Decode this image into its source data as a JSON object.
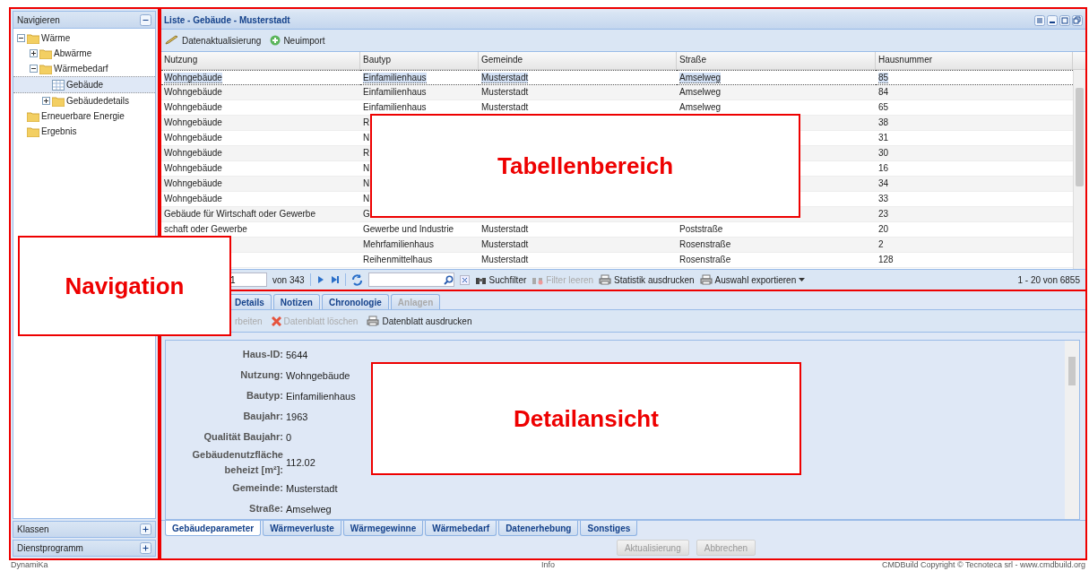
{
  "navigation": {
    "title": "Navigieren",
    "tree": [
      {
        "label": "Wärme",
        "kind": "folder",
        "expanded": true,
        "selected": false,
        "children": [
          {
            "label": "Abwärme",
            "kind": "folder",
            "expanded": false,
            "selected": false,
            "has_children": true
          },
          {
            "label": "Wärmebedarf",
            "kind": "folder",
            "expanded": true,
            "selected": false,
            "children": [
              {
                "label": "Gebäude",
                "kind": "table",
                "selected": true
              },
              {
                "label": "Gebäudedetails",
                "kind": "folder",
                "expanded": false,
                "selected": false,
                "has_children": true
              }
            ]
          }
        ]
      },
      {
        "label": "Erneuerbare Energie",
        "kind": "folder",
        "selected": false
      },
      {
        "label": "Ergebnis",
        "kind": "folder",
        "selected": false
      }
    ],
    "accordion": [
      {
        "label": "Klassen"
      },
      {
        "label": "Dienstprogramm"
      }
    ]
  },
  "list": {
    "title": "Liste - Gebäude - Musterstadt",
    "toolbar": [
      {
        "label": "Datenaktualisierung",
        "kind": "update"
      },
      {
        "label": "Neuimport",
        "kind": "add"
      }
    ],
    "columns": [
      "Nutzung",
      "Bautyp",
      "Gemeinde",
      "Straße",
      "Hausnummer"
    ],
    "rows": [
      {
        "selected": true,
        "nutzung": "Wohngebäude",
        "bautyp": "Einfamilienhaus",
        "gemeinde": "Musterstadt",
        "strasse": "Amselweg",
        "hausnummer": "85"
      },
      {
        "selected": false,
        "nutzung": "Wohngebäude",
        "bautyp": "Einfamilienhaus",
        "gemeinde": "Musterstadt",
        "strasse": "Amselweg",
        "hausnummer": "84"
      },
      {
        "selected": false,
        "nutzung": "Wohngebäude",
        "bautyp": "Einfamilienhaus",
        "gemeinde": "Musterstadt",
        "strasse": "Amselweg",
        "hausnummer": "65"
      },
      {
        "selected": false,
        "nutzung": "Wohngebäude",
        "bautyp": "R",
        "hausnummer": "38"
      },
      {
        "selected": false,
        "nutzung": "Wohngebäude",
        "bautyp": "N",
        "hausnummer": "31"
      },
      {
        "selected": false,
        "nutzung": "Wohngebäude",
        "bautyp": "R",
        "hausnummer": "30"
      },
      {
        "selected": false,
        "nutzung": "Wohngebäude",
        "bautyp": "N",
        "hausnummer": "16"
      },
      {
        "selected": false,
        "nutzung": "Wohngebäude",
        "bautyp": "N",
        "hausnummer": "34"
      },
      {
        "selected": false,
        "nutzung": "Wohngebäude",
        "bautyp": "N",
        "hausnummer": "33"
      },
      {
        "selected": false,
        "nutzung": "Gebäude für Wirtschaft oder Gewerbe",
        "bautyp": "G",
        "hausnummer": "23"
      },
      {
        "selected": false,
        "nutzung": "schaft oder Gewerbe",
        "bautyp": "Gewerbe und Industrie",
        "gemeinde": "Musterstadt",
        "strasse": "Poststraße",
        "hausnummer": "20"
      },
      {
        "selected": false,
        "bautyp": "Mehrfamilienhaus",
        "gemeinde": "Musterstadt",
        "strasse": "Rosenstraße",
        "hausnummer": "2"
      },
      {
        "selected": false,
        "bautyp": "Reihenmittelhaus",
        "gemeinde": "Musterstadt",
        "strasse": "Rosenstraße",
        "hausnummer": "128"
      }
    ],
    "pager": {
      "page": "1",
      "of": "von 343",
      "summary": "1 - 20 von 6855"
    },
    "pager_tools": [
      {
        "label": "Suchfilter",
        "kind": "filter",
        "disabled": false
      },
      {
        "label": "Filter leeren",
        "kind": "clear-filter",
        "disabled": true
      },
      {
        "label": "Statistik ausdrucken",
        "kind": "print",
        "disabled": false
      },
      {
        "label": "Auswahl exportieren",
        "kind": "export",
        "disabled": false
      }
    ]
  },
  "detail": {
    "tabs": [
      {
        "label": "Details",
        "selected": false,
        "disabled": false
      },
      {
        "label": "Notizen",
        "selected": false,
        "disabled": false
      },
      {
        "label": "Chronologie",
        "selected": false,
        "disabled": false
      },
      {
        "label": "Anlagen",
        "selected": false,
        "disabled": true
      }
    ],
    "toolbar": [
      {
        "label": "rbeiten",
        "kind": "edit",
        "disabled": true
      },
      {
        "label": "Datenblatt löschen",
        "kind": "delete",
        "disabled": true
      },
      {
        "label": "Datenblatt ausdrucken",
        "kind": "print",
        "disabled": false
      }
    ],
    "fields": [
      {
        "label": "Haus-ID:",
        "value": "5644"
      },
      {
        "label": "Nutzung:",
        "value": "Wohngebäude"
      },
      {
        "label": "Bautyp:",
        "value": "Einfamilienhaus"
      },
      {
        "label": "Baujahr:",
        "value": "1963"
      },
      {
        "label": "Qualität Baujahr:",
        "value": "0"
      },
      {
        "label": "Gebäudenutzfläche beheizt [m²]:",
        "value": "112.02"
      },
      {
        "label": "Gemeinde:",
        "value": "Musterstadt"
      },
      {
        "label": "Straße:",
        "value": "Amselweg"
      }
    ],
    "bottom_tabs": [
      {
        "label": "Gebäudeparameter",
        "selected": true
      },
      {
        "label": "Wärmeverluste",
        "selected": false
      },
      {
        "label": "Wärmegewinne",
        "selected": false
      },
      {
        "label": "Wärmebedarf",
        "selected": false
      },
      {
        "label": "Datenerhebung",
        "selected": false
      },
      {
        "label": "Sonstiges",
        "selected": false
      }
    ],
    "buttons": [
      {
        "label": "Aktualisierung",
        "disabled": true
      },
      {
        "label": "Abbrechen",
        "disabled": true
      }
    ]
  },
  "footer": {
    "left": "DynamiKa",
    "center": "Info",
    "right": "CMDBuild Copyright © Tecnoteca srl - www.cmdbuild.org"
  },
  "annotations": [
    {
      "text": "Tabellenbereich"
    },
    {
      "text": "Navigation"
    },
    {
      "text": "Detailansicht"
    }
  ]
}
